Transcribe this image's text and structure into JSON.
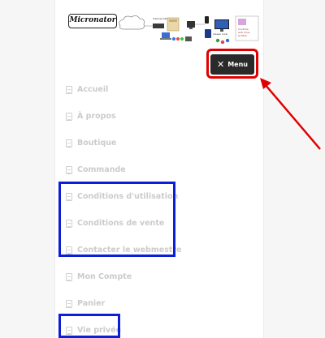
{
  "header": {
    "logo_text": "Micronator",
    "diagram_label": "network diagram"
  },
  "menu_button": {
    "icon": "close-icon",
    "close_glyph": "✕",
    "label": "Menu"
  },
  "nav": {
    "items": [
      {
        "label": "Accueil"
      },
      {
        "label": "À propos"
      },
      {
        "label": "Boutique"
      },
      {
        "label": "Commande"
      },
      {
        "label": "Conditions d'utilisation"
      },
      {
        "label": "Conditions de vente"
      },
      {
        "label": "Contacter le webmestre"
      },
      {
        "label": "Mon Compte"
      },
      {
        "label": "Panier"
      },
      {
        "label": "Vie privée"
      }
    ]
  },
  "annotations": {
    "highlight_color": "#e10000",
    "group_color": "#0c1ed6"
  }
}
